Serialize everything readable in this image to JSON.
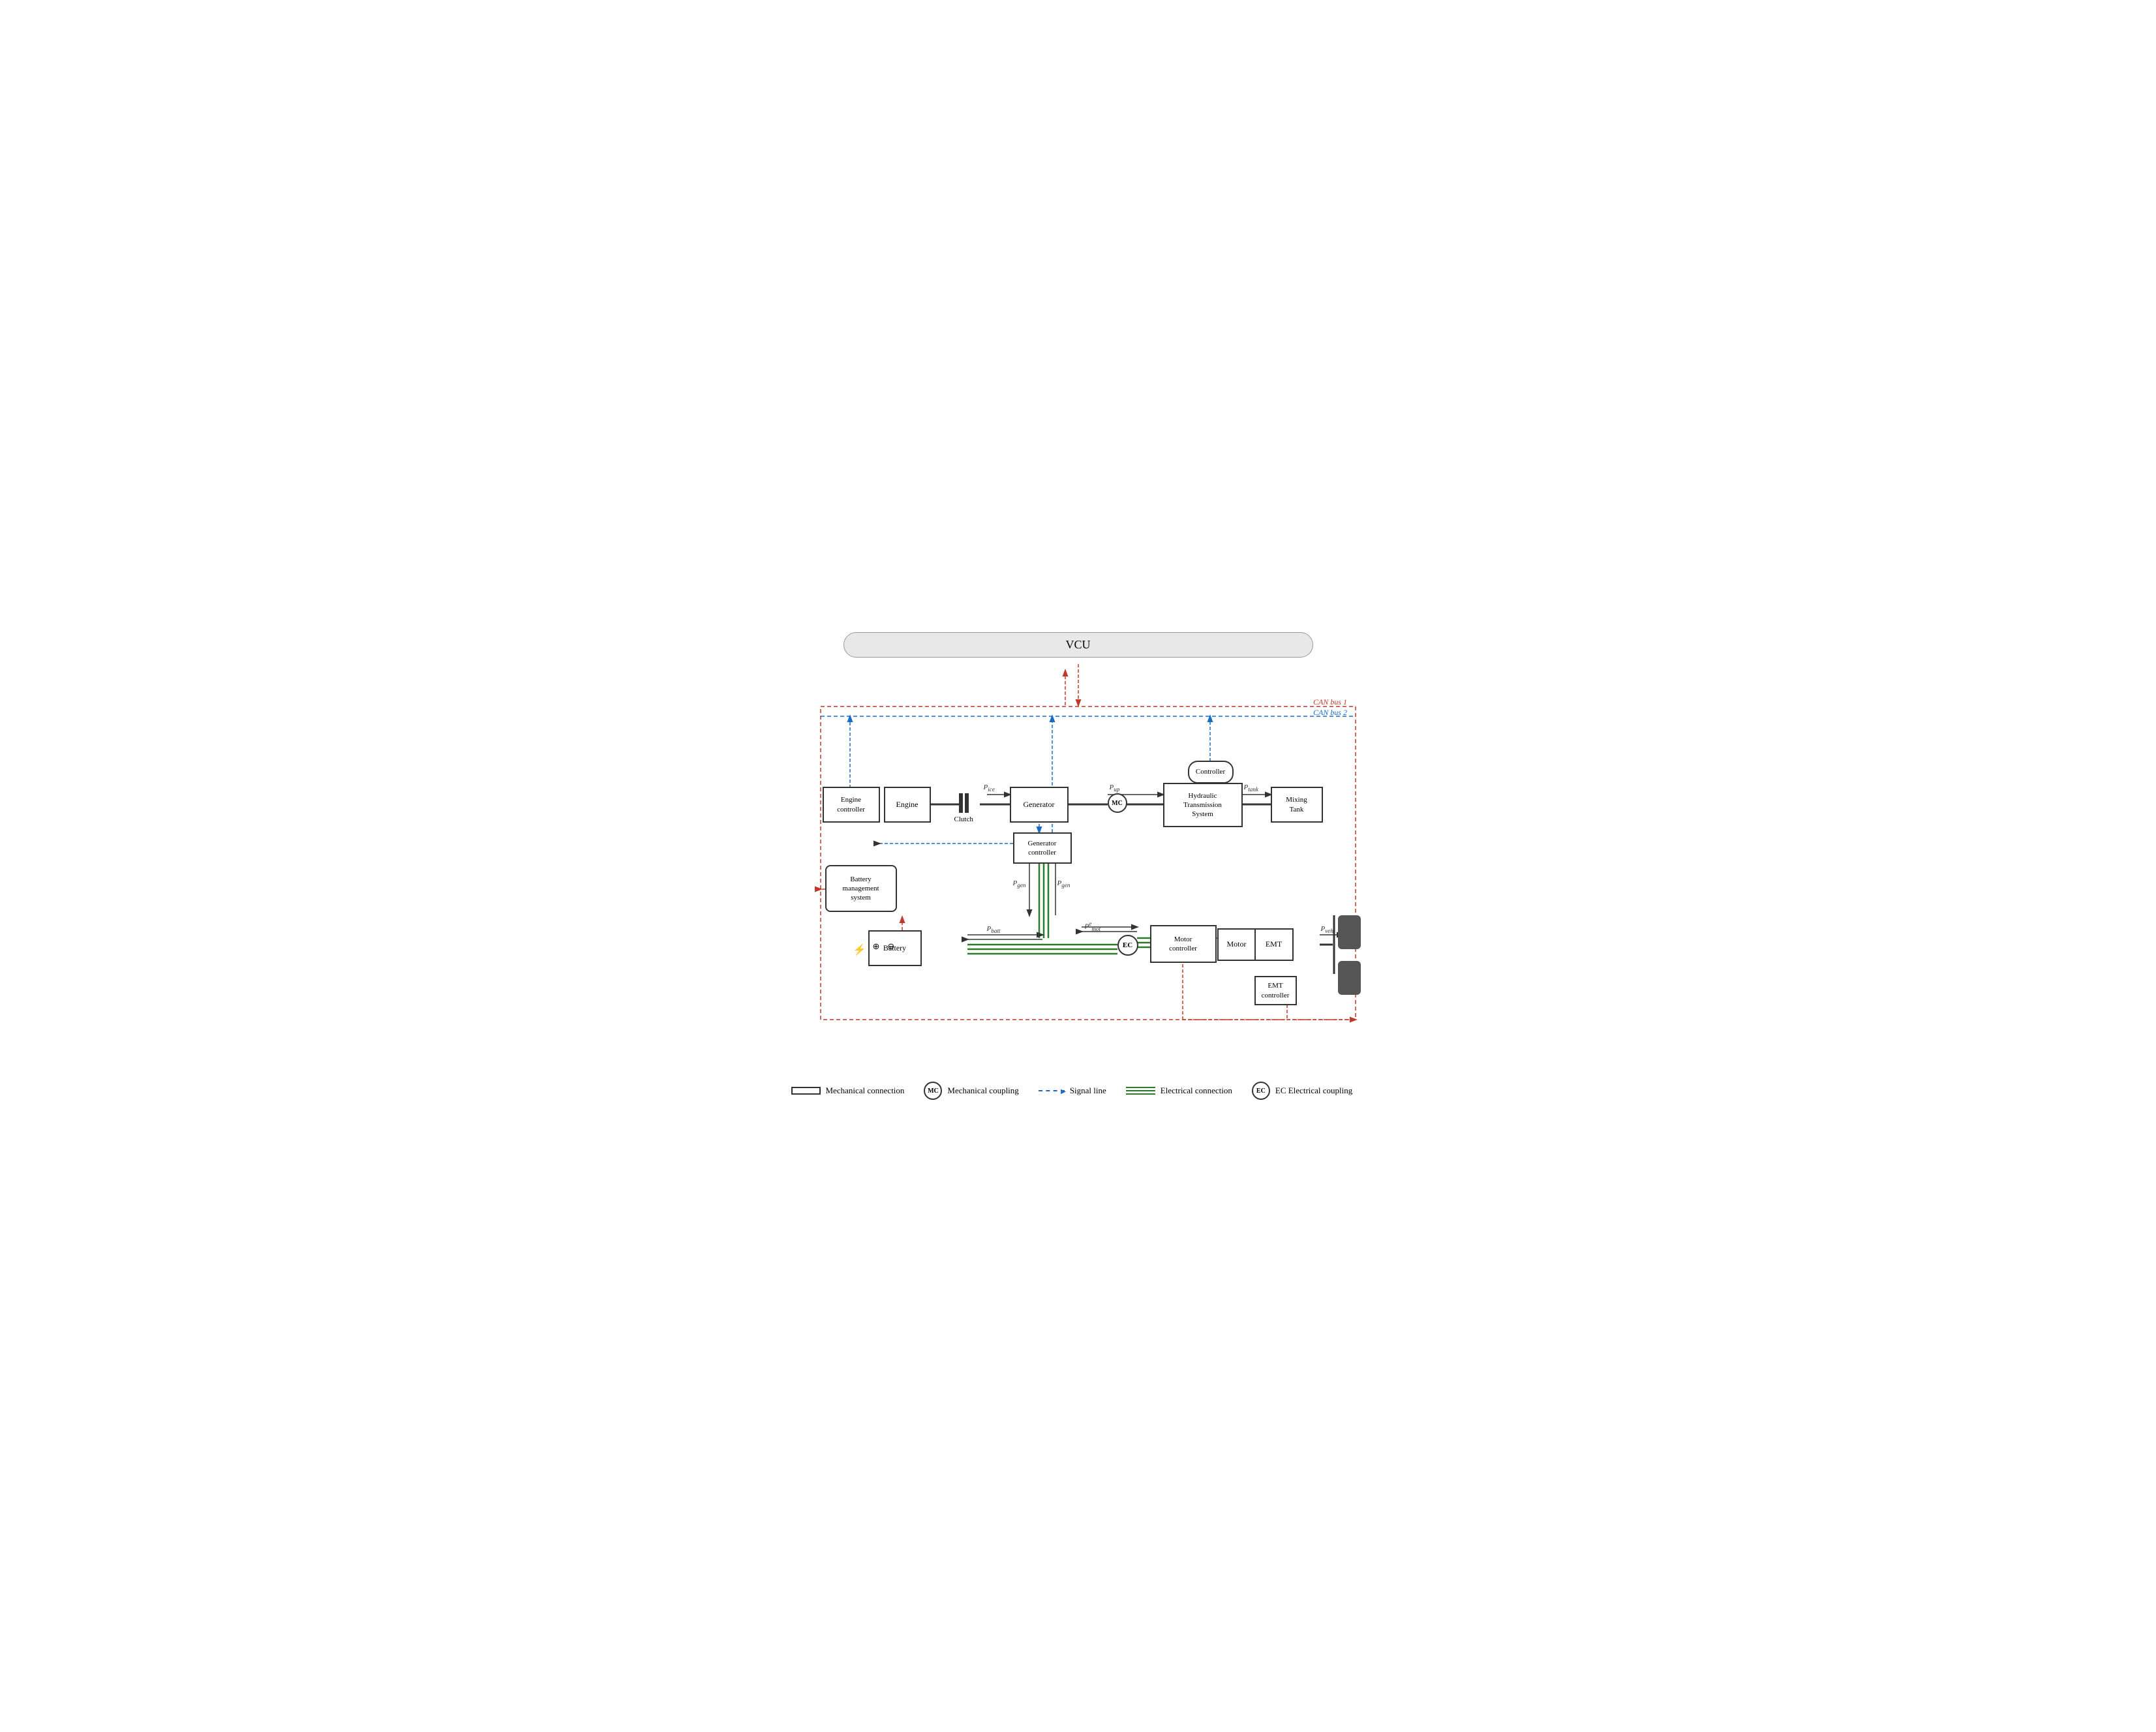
{
  "title": "VCU",
  "components": {
    "vcu": "VCU",
    "engine_controller": "Engine\ncontroller",
    "engine": "Engine",
    "generator": "Generator",
    "generator_controller": "Generator\ncontroller",
    "mc": "MC",
    "controller": "Controller",
    "hydraulic": "Hydraulic\nTransmission\nSystem",
    "mixing_tank": "Mixing\nTank",
    "battery_management": "Battery\nmanagement\nsystem",
    "battery": "Battery",
    "ec": "EC",
    "motor_controller": "Motor\ncontroller",
    "motor": "Motor",
    "emt": "EMT",
    "emt_controller": "EMT\ncontroller",
    "clutch": "Clutch"
  },
  "power_labels": {
    "p_ice": "P_ice",
    "p_up": "P_up",
    "p_tank": "P_tank",
    "p_gen_down": "P_gen",
    "p_gen_up": "P_gen",
    "p_batt": "P_batt",
    "p_mot": "P_mot_e",
    "p_veh": "P_veh"
  },
  "can_labels": {
    "can1": "CAN bus 1",
    "can2": "CAN bus 2"
  },
  "legend": {
    "mechanical_connection": "Mechanical connection",
    "mechanical_coupling": "Mechanical coupling",
    "electrical_connection": "Electrical connection",
    "electrical_coupling": "EC  Electrical coupling",
    "signal_line": "Signal line"
  },
  "colors": {
    "can1": "#c0392b",
    "can2": "#1a6bc5",
    "green": "#2a7a2a",
    "dark": "#333",
    "arrow_black": "#333"
  }
}
